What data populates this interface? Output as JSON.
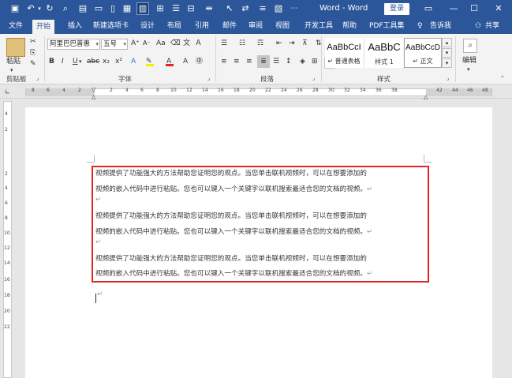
{
  "title_bar": {
    "doc_title": "Word - Word",
    "login_label": "登录"
  },
  "quick_access": [
    "save-icon",
    "undo-icon",
    "redo-icon",
    "print-preview-icon",
    "open-icon",
    "new-icon",
    "document-view-icon",
    "grid-icon",
    "bullets-icon",
    "table-icon",
    "spacing-icon",
    "selection-icon",
    "more-icon"
  ],
  "tabs": [
    "文件",
    "开始",
    "插入",
    "新建选项卡",
    "设计",
    "布局",
    "引用",
    "邮件",
    "审阅",
    "视图",
    "开发工具",
    "帮助",
    "PDF工具集"
  ],
  "active_tab": "开始",
  "tell_me": "告诉我",
  "share": "共享",
  "ribbon": {
    "clipboard": {
      "paste_label": "粘贴",
      "group_label": "剪贴板"
    },
    "font": {
      "font_name": "阿里巴巴普惠",
      "font_size": "五号",
      "group_label": "字体",
      "font_color": "#e32424",
      "highlight_color": "#f5f000"
    },
    "paragraph": {
      "group_label": "段落"
    },
    "styles": {
      "group_label": "样式",
      "items": [
        {
          "sample": "AaBbCcI",
          "name": "↵ 普通表格"
        },
        {
          "sample": "AaBbC",
          "name": "样式 1"
        },
        {
          "sample": "AaBbCcD",
          "name": "↵ 正文"
        }
      ]
    },
    "editing": {
      "label": "编辑"
    }
  },
  "ruler": {
    "h_numbers": [
      "8",
      "6",
      "4",
      "2",
      "",
      "2",
      "4",
      "6",
      "8",
      "10",
      "12",
      "14",
      "16",
      "18",
      "20",
      "22",
      "24",
      "26",
      "28",
      "30",
      "32",
      "34",
      "36",
      "38",
      "",
      "42",
      "44",
      "46",
      "48"
    ],
    "v_numbers": [
      "4",
      "2",
      "",
      "2",
      "4",
      "6",
      "8",
      "10",
      "12",
      "14",
      "16",
      "18",
      "20",
      "22"
    ]
  },
  "document": {
    "paragraphs": [
      {
        "line1": "视频提供了功能强大的方法帮助您证明您的观点。当您单击联机视频时，可以在想要添加的",
        "line2": "视频的嵌入代码中进行粘贴。您也可以键入一个关键字以联机搜索最适合您的文档的视频。"
      },
      {
        "line1": "视频提供了功能强大的方法帮助您证明您的观点。当您单击联机视频时，可以在想要添加的",
        "line2": "视频的嵌入代码中进行粘贴。您也可以键入一个关键字以联机搜索最适合您的文档的视频。"
      },
      {
        "line1": "视频提供了功能强大的方法帮助您证明您的观点。当您单击联机视频时，可以在想要添加的",
        "line2": "视频的嵌入代码中进行粘贴。您也可以键入一个关键字以联机搜索最适合您的文档的视频。"
      }
    ],
    "return_mark": "↵",
    "highlight_color": "#e22328"
  }
}
